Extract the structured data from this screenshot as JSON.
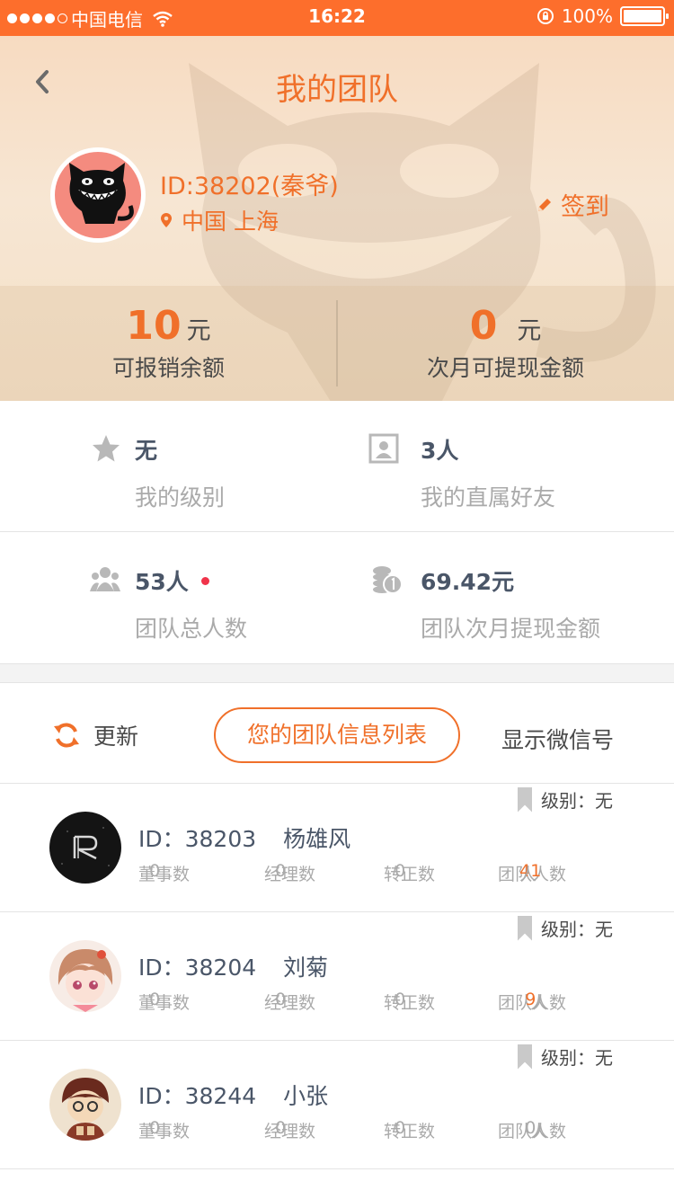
{
  "status_bar": {
    "carrier": "中国电信",
    "time": "16:22",
    "battery": "100%"
  },
  "header": {
    "title": "我的团队",
    "user_id": "ID:38202(秦爷)",
    "location": "中国 上海",
    "checkin_label": "签到"
  },
  "balances": [
    {
      "amount": "10",
      "unit": "元",
      "label": "可报销余额"
    },
    {
      "amount": "0",
      "unit": "元",
      "label": "次月可提现金额"
    }
  ],
  "stats": [
    {
      "icon": "star-icon",
      "value": "无",
      "label": "我的级别"
    },
    {
      "icon": "contact-card-icon",
      "value": "3人",
      "label": "我的直属好友"
    },
    {
      "icon": "group-icon",
      "value": "53人",
      "label": "团队总人数",
      "new_badge": true
    },
    {
      "icon": "coins-icon",
      "value": "69.42元",
      "label": "团队次月提现金额"
    }
  ],
  "toolbar": {
    "refresh_label": "更新",
    "team_list_label": "您的团队信息列表",
    "show_wechat_label": "显示微信号"
  },
  "members_labels": {
    "level_prefix": "级别：",
    "id_prefix": "ID：",
    "directors": "董事数",
    "managers": "经理数",
    "regulars": "转正数",
    "team_size": "团队人数",
    "person_unit": "人"
  },
  "members": [
    {
      "id": "38203",
      "name": "杨雄风",
      "level": "无",
      "directors": "0",
      "managers": "0",
      "regulars": "0",
      "team_size": "41",
      "avatar": "dark-logo-avatar"
    },
    {
      "id": "38204",
      "name": "刘菊",
      "level": "无",
      "directors": "0",
      "managers": "0",
      "regulars": "0",
      "team_size": "9",
      "avatar": "anime-girl-avatar"
    },
    {
      "id": "38244",
      "name": "小张",
      "level": "无",
      "directors": "0",
      "managers": "0",
      "regulars": "0",
      "team_size": "0",
      "avatar": "cartoon-boy-avatar"
    }
  ],
  "colors": {
    "accent": "#f0702a",
    "status_bar": "#fd6e2c",
    "text_dark": "#4a5668",
    "text_muted": "#aaaaaa",
    "badge_red": "#f0334a"
  }
}
